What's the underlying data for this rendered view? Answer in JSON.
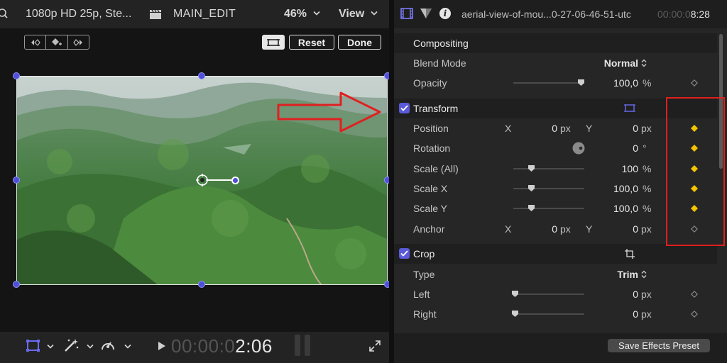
{
  "viewer": {
    "format_label": "1080p HD 25p, Ste...",
    "project_name": "MAIN_EDIT",
    "zoom": "46%",
    "view_menu": "View",
    "reset_label": "Reset",
    "done_label": "Done",
    "timecode_dim": "00:00:0",
    "timecode_active": "2:06"
  },
  "inspector": {
    "clip_name": "aerial-view-of-mou...0-27-06-46-51-utc",
    "clip_duration_dim": "00:00:0",
    "clip_duration_active": "8:28",
    "compositing": {
      "title": "Compositing",
      "blend_mode_label": "Blend Mode",
      "blend_mode_value": "Normal",
      "opacity_label": "Opacity",
      "opacity_value": "100,0",
      "opacity_unit": "%"
    },
    "transform": {
      "title": "Transform",
      "position_label": "Position",
      "position_x_axis": "X",
      "position_x": "0",
      "position_x_unit": "px",
      "position_y_axis": "Y",
      "position_y": "0",
      "position_y_unit": "px",
      "rotation_label": "Rotation",
      "rotation_value": "0",
      "rotation_unit": "°",
      "scale_all_label": "Scale (All)",
      "scale_all_value": "100",
      "scale_all_unit": "%",
      "scale_x_label": "Scale X",
      "scale_x_value": "100,0",
      "scale_x_unit": "%",
      "scale_y_label": "Scale Y",
      "scale_y_value": "100,0",
      "scale_y_unit": "%",
      "anchor_label": "Anchor",
      "anchor_x_axis": "X",
      "anchor_x": "0",
      "anchor_x_unit": "px",
      "anchor_y_axis": "Y",
      "anchor_y": "0",
      "anchor_y_unit": "px"
    },
    "crop": {
      "title": "Crop",
      "type_label": "Type",
      "type_value": "Trim",
      "left_label": "Left",
      "left_value": "0",
      "left_unit": "px",
      "right_label": "Right",
      "right_value": "0",
      "right_unit": "px"
    },
    "save_preset_label": "Save Effects Preset"
  },
  "colors": {
    "accent": "#5a5ad8",
    "keyframe_active": "#f5c400",
    "annotation": "#e02020"
  }
}
